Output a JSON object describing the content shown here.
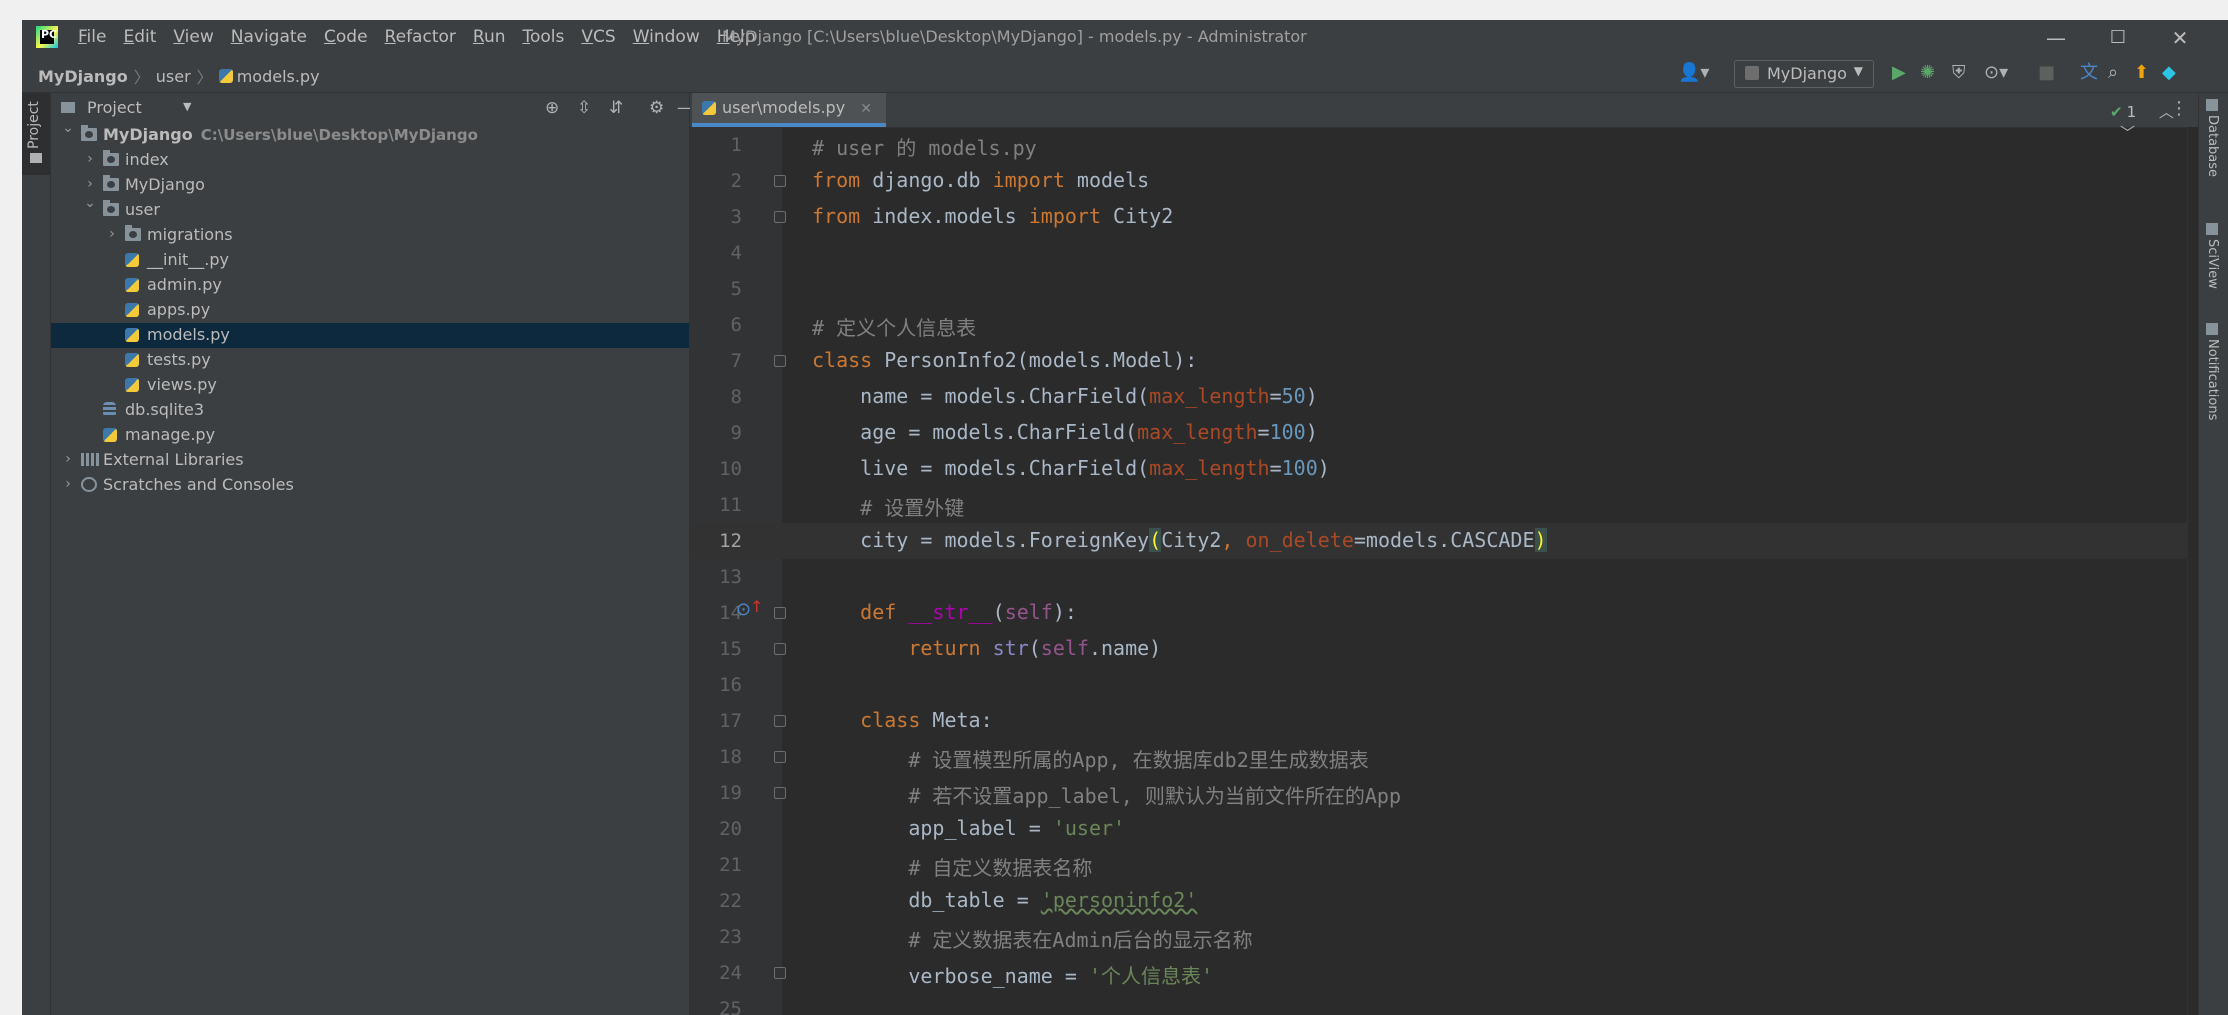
{
  "titlebar": {
    "menu": [
      {
        "u": "F",
        "rest": "ile"
      },
      {
        "u": "E",
        "rest": "dit"
      },
      {
        "u": "V",
        "rest": "iew"
      },
      {
        "u": "N",
        "rest": "avigate"
      },
      {
        "u": "C",
        "rest": "ode"
      },
      {
        "u": "R",
        "rest": "efactor"
      },
      {
        "u": "R",
        "rest": "un"
      },
      {
        "u": "T",
        "rest": "ools"
      },
      {
        "u": "V",
        "rest": "CS"
      },
      {
        "u": "W",
        "rest": "indow"
      },
      {
        "u": "H",
        "rest": "elp"
      }
    ],
    "window_title": "MyDjango [C:\\Users\\blue\\Desktop\\MyDjango] - models.py - Administrator",
    "minimize": "—",
    "maximize": "☐",
    "close": "✕"
  },
  "navbar": {
    "breadcrumb": [
      "MyDjango",
      "user",
      "models.py"
    ],
    "run_config": "MyDjango",
    "icons": [
      "user-icon",
      "run-icon",
      "debug-icon",
      "coverage-icon",
      "profile-icon",
      "stop-icon",
      "translate-icon",
      "search-icon",
      "update-icon",
      "plugin-icon"
    ]
  },
  "left_strip": {
    "project_tab": "Project"
  },
  "project_panel": {
    "title": "Project",
    "tree": [
      {
        "name": "MyDjango",
        "path": "C:\\Users\\blue\\Desktop\\MyDjango",
        "depth": 0,
        "arrow": "v",
        "icon": "folder",
        "bold": true
      },
      {
        "name": "index",
        "depth": 1,
        "arrow": ">",
        "icon": "folder"
      },
      {
        "name": "MyDjango",
        "depth": 1,
        "arrow": ">",
        "icon": "folder"
      },
      {
        "name": "user",
        "depth": 1,
        "arrow": "v",
        "icon": "folder"
      },
      {
        "name": "migrations",
        "depth": 2,
        "arrow": ">",
        "icon": "folder"
      },
      {
        "name": "__init__.py",
        "depth": 2,
        "icon": "py"
      },
      {
        "name": "admin.py",
        "depth": 2,
        "icon": "py"
      },
      {
        "name": "apps.py",
        "depth": 2,
        "icon": "py"
      },
      {
        "name": "models.py",
        "depth": 2,
        "icon": "py",
        "selected": true
      },
      {
        "name": "tests.py",
        "depth": 2,
        "icon": "py"
      },
      {
        "name": "views.py",
        "depth": 2,
        "icon": "py"
      },
      {
        "name": "db.sqlite3",
        "depth": 1,
        "icon": "db"
      },
      {
        "name": "manage.py",
        "depth": 1,
        "icon": "py"
      },
      {
        "name": "External Libraries",
        "depth": 0,
        "arrow": ">",
        "icon": "lib"
      },
      {
        "name": "Scratches and Consoles",
        "depth": 0,
        "arrow": ">",
        "icon": "scratch"
      }
    ]
  },
  "editor": {
    "tab_label": "user\\models.py",
    "inspection_count": "1",
    "current_line": 12,
    "lines": [
      {
        "n": "1",
        "tokens": [
          [
            "# user 的 models.py",
            "#808080"
          ]
        ]
      },
      {
        "n": "2",
        "fold": true,
        "tokens": [
          [
            "from",
            "#cc7832"
          ],
          [
            " django.db ",
            "#a9b7c6"
          ],
          [
            "import",
            "#cc7832"
          ],
          [
            " models",
            "#a9b7c6"
          ]
        ]
      },
      {
        "n": "3",
        "fold": true,
        "tokens": [
          [
            "from",
            "#cc7832"
          ],
          [
            " index.models ",
            "#a9b7c6"
          ],
          [
            "import",
            "#cc7832"
          ],
          [
            " City2",
            "#a9b7c6"
          ]
        ]
      },
      {
        "n": "4",
        "tokens": []
      },
      {
        "n": "5",
        "tokens": []
      },
      {
        "n": "6",
        "tokens": [
          [
            "# 定义个人信息表",
            "#808080"
          ]
        ]
      },
      {
        "n": "7",
        "fold": true,
        "tokens": [
          [
            "class",
            "#cc7832"
          ],
          [
            " PersonInfo2(models.Model):",
            "#a9b7c6"
          ]
        ]
      },
      {
        "n": "8",
        "tokens": [
          [
            "    name = models.CharField(",
            "#a9b7c6"
          ],
          [
            "max_length",
            "#aa4926"
          ],
          [
            "=",
            "#a9b7c6"
          ],
          [
            "50",
            "#6897bb"
          ],
          [
            ")",
            "#a9b7c6"
          ]
        ]
      },
      {
        "n": "9",
        "tokens": [
          [
            "    age = models.CharField(",
            "#a9b7c6"
          ],
          [
            "max_length",
            "#aa4926"
          ],
          [
            "=",
            "#a9b7c6"
          ],
          [
            "100",
            "#6897bb"
          ],
          [
            ")",
            "#a9b7c6"
          ]
        ]
      },
      {
        "n": "10",
        "tokens": [
          [
            "    live = models.CharField(",
            "#a9b7c6"
          ],
          [
            "max_length",
            "#aa4926"
          ],
          [
            "=",
            "#a9b7c6"
          ],
          [
            "100",
            "#6897bb"
          ],
          [
            ")",
            "#a9b7c6"
          ]
        ]
      },
      {
        "n": "11",
        "tokens": [
          [
            "    # 设置外键",
            "#808080"
          ]
        ]
      },
      {
        "n": "12",
        "tokens": [
          [
            "    city = models.ForeignKey",
            "#a9b7c6"
          ],
          [
            "(",
            "#ffef28"
          ],
          [
            "City2",
            "#a9b7c6"
          ],
          [
            ", ",
            "#cc7832"
          ],
          [
            "on_delete",
            "#aa4926"
          ],
          [
            "=models.CASCADE",
            "#a9b7c6"
          ],
          [
            ")",
            "#ffef28"
          ]
        ]
      },
      {
        "n": "13",
        "tokens": []
      },
      {
        "n": "14",
        "fold": true,
        "marker": true,
        "tokens": [
          [
            "    ",
            "#a9b7c6"
          ],
          [
            "def",
            "#cc7832"
          ],
          [
            " ",
            "#a9b7c6"
          ],
          [
            "__str__",
            "#b200b2"
          ],
          [
            "(",
            "#a9b7c6"
          ],
          [
            "self",
            "#94558d"
          ],
          [
            "):",
            "#a9b7c6"
          ]
        ]
      },
      {
        "n": "15",
        "fold": true,
        "tokens": [
          [
            "        ",
            "#a9b7c6"
          ],
          [
            "return",
            "#cc7832"
          ],
          [
            " ",
            "#a9b7c6"
          ],
          [
            "str",
            "#8888c6"
          ],
          [
            "(",
            "#a9b7c6"
          ],
          [
            "self",
            "#94558d"
          ],
          [
            ".name)",
            "#a9b7c6"
          ]
        ]
      },
      {
        "n": "16",
        "tokens": []
      },
      {
        "n": "17",
        "fold": true,
        "tokens": [
          [
            "    ",
            "#a9b7c6"
          ],
          [
            "class",
            "#cc7832"
          ],
          [
            " Meta:",
            "#a9b7c6"
          ]
        ]
      },
      {
        "n": "18",
        "fold": true,
        "tokens": [
          [
            "        # 设置模型所属的App, 在数据库db2里生成数据表",
            "#808080"
          ]
        ]
      },
      {
        "n": "19",
        "fold": true,
        "tokens": [
          [
            "        # 若不设置app_label, 则默认为当前文件所在的App",
            "#808080"
          ]
        ]
      },
      {
        "n": "20",
        "tokens": [
          [
            "        app_label = ",
            "#a9b7c6"
          ],
          [
            "'user'",
            "#6a8759"
          ]
        ]
      },
      {
        "n": "21",
        "tokens": [
          [
            "        # 自定义数据表名称",
            "#808080"
          ]
        ]
      },
      {
        "n": "22",
        "tokens": [
          [
            "        db_table = ",
            "#a9b7c6"
          ],
          [
            "'personinfo2'",
            "#6a8759"
          ]
        ]
      },
      {
        "n": "23",
        "tokens": [
          [
            "        # 定义数据表在Admin后台的显示名称",
            "#808080"
          ]
        ]
      },
      {
        "n": "24",
        "fold": true,
        "tokens": [
          [
            "        verbose_name = ",
            "#a9b7c6"
          ],
          [
            "'个人信息表'",
            "#6a8759"
          ]
        ]
      },
      {
        "n": "25",
        "tokens": []
      }
    ]
  },
  "right_strip": [
    "Database",
    "SciView",
    "Notifications"
  ]
}
